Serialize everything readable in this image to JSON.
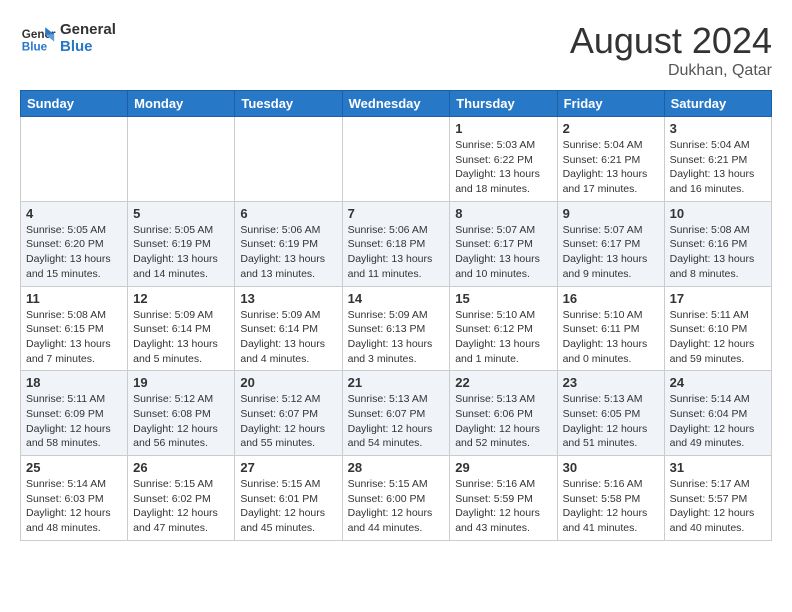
{
  "header": {
    "logo_line1": "General",
    "logo_line2": "Blue",
    "month_title": "August 2024",
    "location": "Dukhan, Qatar"
  },
  "weekdays": [
    "Sunday",
    "Monday",
    "Tuesday",
    "Wednesday",
    "Thursday",
    "Friday",
    "Saturday"
  ],
  "weeks": [
    [
      {
        "day": "",
        "info": ""
      },
      {
        "day": "",
        "info": ""
      },
      {
        "day": "",
        "info": ""
      },
      {
        "day": "",
        "info": ""
      },
      {
        "day": "1",
        "info": "Sunrise: 5:03 AM\nSunset: 6:22 PM\nDaylight: 13 hours\nand 18 minutes."
      },
      {
        "day": "2",
        "info": "Sunrise: 5:04 AM\nSunset: 6:21 PM\nDaylight: 13 hours\nand 17 minutes."
      },
      {
        "day": "3",
        "info": "Sunrise: 5:04 AM\nSunset: 6:21 PM\nDaylight: 13 hours\nand 16 minutes."
      }
    ],
    [
      {
        "day": "4",
        "info": "Sunrise: 5:05 AM\nSunset: 6:20 PM\nDaylight: 13 hours\nand 15 minutes."
      },
      {
        "day": "5",
        "info": "Sunrise: 5:05 AM\nSunset: 6:19 PM\nDaylight: 13 hours\nand 14 minutes."
      },
      {
        "day": "6",
        "info": "Sunrise: 5:06 AM\nSunset: 6:19 PM\nDaylight: 13 hours\nand 13 minutes."
      },
      {
        "day": "7",
        "info": "Sunrise: 5:06 AM\nSunset: 6:18 PM\nDaylight: 13 hours\nand 11 minutes."
      },
      {
        "day": "8",
        "info": "Sunrise: 5:07 AM\nSunset: 6:17 PM\nDaylight: 13 hours\nand 10 minutes."
      },
      {
        "day": "9",
        "info": "Sunrise: 5:07 AM\nSunset: 6:17 PM\nDaylight: 13 hours\nand 9 minutes."
      },
      {
        "day": "10",
        "info": "Sunrise: 5:08 AM\nSunset: 6:16 PM\nDaylight: 13 hours\nand 8 minutes."
      }
    ],
    [
      {
        "day": "11",
        "info": "Sunrise: 5:08 AM\nSunset: 6:15 PM\nDaylight: 13 hours\nand 7 minutes."
      },
      {
        "day": "12",
        "info": "Sunrise: 5:09 AM\nSunset: 6:14 PM\nDaylight: 13 hours\nand 5 minutes."
      },
      {
        "day": "13",
        "info": "Sunrise: 5:09 AM\nSunset: 6:14 PM\nDaylight: 13 hours\nand 4 minutes."
      },
      {
        "day": "14",
        "info": "Sunrise: 5:09 AM\nSunset: 6:13 PM\nDaylight: 13 hours\nand 3 minutes."
      },
      {
        "day": "15",
        "info": "Sunrise: 5:10 AM\nSunset: 6:12 PM\nDaylight: 13 hours\nand 1 minute."
      },
      {
        "day": "16",
        "info": "Sunrise: 5:10 AM\nSunset: 6:11 PM\nDaylight: 13 hours\nand 0 minutes."
      },
      {
        "day": "17",
        "info": "Sunrise: 5:11 AM\nSunset: 6:10 PM\nDaylight: 12 hours\nand 59 minutes."
      }
    ],
    [
      {
        "day": "18",
        "info": "Sunrise: 5:11 AM\nSunset: 6:09 PM\nDaylight: 12 hours\nand 58 minutes."
      },
      {
        "day": "19",
        "info": "Sunrise: 5:12 AM\nSunset: 6:08 PM\nDaylight: 12 hours\nand 56 minutes."
      },
      {
        "day": "20",
        "info": "Sunrise: 5:12 AM\nSunset: 6:07 PM\nDaylight: 12 hours\nand 55 minutes."
      },
      {
        "day": "21",
        "info": "Sunrise: 5:13 AM\nSunset: 6:07 PM\nDaylight: 12 hours\nand 54 minutes."
      },
      {
        "day": "22",
        "info": "Sunrise: 5:13 AM\nSunset: 6:06 PM\nDaylight: 12 hours\nand 52 minutes."
      },
      {
        "day": "23",
        "info": "Sunrise: 5:13 AM\nSunset: 6:05 PM\nDaylight: 12 hours\nand 51 minutes."
      },
      {
        "day": "24",
        "info": "Sunrise: 5:14 AM\nSunset: 6:04 PM\nDaylight: 12 hours\nand 49 minutes."
      }
    ],
    [
      {
        "day": "25",
        "info": "Sunrise: 5:14 AM\nSunset: 6:03 PM\nDaylight: 12 hours\nand 48 minutes."
      },
      {
        "day": "26",
        "info": "Sunrise: 5:15 AM\nSunset: 6:02 PM\nDaylight: 12 hours\nand 47 minutes."
      },
      {
        "day": "27",
        "info": "Sunrise: 5:15 AM\nSunset: 6:01 PM\nDaylight: 12 hours\nand 45 minutes."
      },
      {
        "day": "28",
        "info": "Sunrise: 5:15 AM\nSunset: 6:00 PM\nDaylight: 12 hours\nand 44 minutes."
      },
      {
        "day": "29",
        "info": "Sunrise: 5:16 AM\nSunset: 5:59 PM\nDaylight: 12 hours\nand 43 minutes."
      },
      {
        "day": "30",
        "info": "Sunrise: 5:16 AM\nSunset: 5:58 PM\nDaylight: 12 hours\nand 41 minutes."
      },
      {
        "day": "31",
        "info": "Sunrise: 5:17 AM\nSunset: 5:57 PM\nDaylight: 12 hours\nand 40 minutes."
      }
    ]
  ]
}
